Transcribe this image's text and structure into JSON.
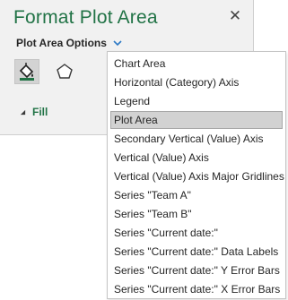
{
  "pane": {
    "title": "Format Plot Area",
    "close_glyph": "✕",
    "options_label": "Plot Area Options",
    "icons": [
      "fill-line-icon",
      "effects-pentagon-icon"
    ],
    "section": {
      "label": "Fill",
      "expanded": false
    }
  },
  "menu": {
    "selected": "Plot Area",
    "items": [
      "Chart Area",
      "Horizontal (Category) Axis",
      "Legend",
      "Plot Area",
      "Secondary Vertical (Value) Axis",
      "Vertical (Value) Axis",
      "Vertical (Value) Axis Major Gridlines",
      "Series \"Team A\"",
      "Series \"Team B\"",
      "Series \"Current date:\"",
      "Series \"Current date:\" Data Labels",
      "Series \"Current date:\" Y Error Bars",
      "Series \"Current date:\" X Error Bars"
    ]
  },
  "colors": {
    "accent": "#217346",
    "chevron": "#2b78c5",
    "pane_bg": "#f1f1f1"
  }
}
